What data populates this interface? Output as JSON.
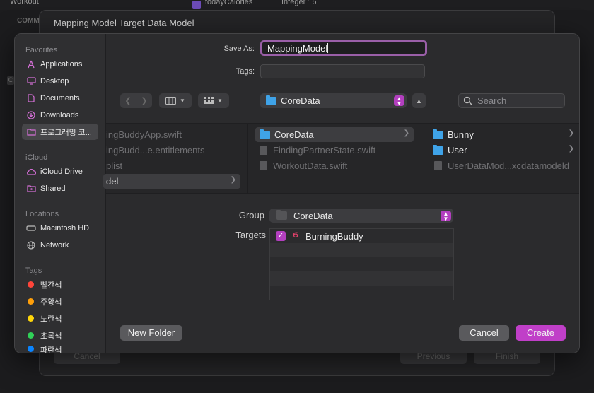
{
  "background": {
    "workout": "Workout",
    "comm": "COMM",
    "attr_name": "todayCalories",
    "attr_type": "Integer 16"
  },
  "sheet": {
    "title": "Mapping Model Target Data Model",
    "cancel": "Cancel",
    "previous": "Previous",
    "finish": "Finish"
  },
  "sidebar": {
    "favorites_header": "Favorites",
    "favorites": [
      {
        "label": "Applications",
        "icon": "applications-icon"
      },
      {
        "label": "Desktop",
        "icon": "desktop-icon"
      },
      {
        "label": "Documents",
        "icon": "document-icon"
      },
      {
        "label": "Downloads",
        "icon": "downloads-icon"
      },
      {
        "label": "프로그래밍 코...",
        "icon": "folder-icon"
      }
    ],
    "icloud_header": "iCloud",
    "icloud": [
      {
        "label": "iCloud Drive",
        "icon": "cloud-icon"
      },
      {
        "label": "Shared",
        "icon": "shared-folder-icon"
      }
    ],
    "locations_header": "Locations",
    "locations": [
      {
        "label": "Macintosh HD",
        "icon": "disk-icon"
      },
      {
        "label": "Network",
        "icon": "globe-icon"
      }
    ],
    "tags_header": "Tags",
    "tags": [
      {
        "label": "빨간색",
        "color": "#ff453a"
      },
      {
        "label": "주황색",
        "color": "#ff9f0a"
      },
      {
        "label": "노란색",
        "color": "#ffd60a"
      },
      {
        "label": "초록색",
        "color": "#30d158"
      },
      {
        "label": "파란색",
        "color": "#0a84ff"
      }
    ]
  },
  "form": {
    "save_as_label": "Save As:",
    "save_as_value": "MappingModel",
    "tags_label": "Tags:",
    "location": "CoreData",
    "search_placeholder": "Search"
  },
  "browser": {
    "col1": [
      {
        "label": "ingBuddyApp.swift",
        "dim": true
      },
      {
        "label": "ingBudd...e.entitlements",
        "dim": true
      },
      {
        "label": "plist",
        "dim": true
      },
      {
        "label": "del",
        "dim": false
      }
    ],
    "col2": [
      {
        "label": "CoreData",
        "dim": false
      },
      {
        "label": "FindingPartnerState.swift",
        "dim": true
      },
      {
        "label": "WorkoutData.swift",
        "dim": true
      }
    ],
    "col3": [
      {
        "label": "Bunny",
        "dim": false
      },
      {
        "label": "User",
        "dim": false
      },
      {
        "label": "UserDataMod...xcdatamodeld",
        "dim": true
      }
    ]
  },
  "group": {
    "label": "Group",
    "value": "CoreData"
  },
  "targets": {
    "label": "Targets",
    "items": [
      {
        "label": "BurningBuddy",
        "checked": true
      }
    ]
  },
  "buttons": {
    "new_folder": "New Folder",
    "cancel": "Cancel",
    "create": "Create"
  },
  "colors": {
    "accent": "#c03fc8",
    "folder_blue": "#3fa3e8"
  }
}
